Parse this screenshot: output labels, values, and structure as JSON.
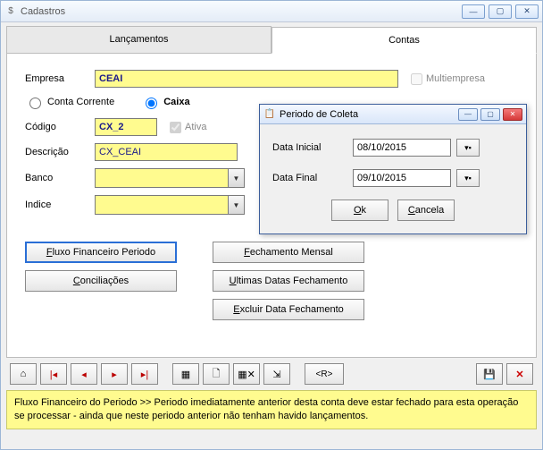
{
  "window": {
    "title": "Cadastros"
  },
  "tabs": {
    "lancamentos": "Lançamentos",
    "contas": "Contas"
  },
  "form": {
    "empresa_label": "Empresa",
    "empresa_value": "CEAI",
    "multiempresa_label": "Multiempresa",
    "radio_conta": "Conta Corrente",
    "radio_caixa": "Caixa",
    "codigo_label": "Código",
    "codigo_value": "CX_2",
    "ativa_label": "Ativa",
    "descricao_label": "Descrição",
    "descricao_value": "CX_CEAI",
    "banco_label": "Banco",
    "indice_label": "Indice"
  },
  "buttons": {
    "fluxo": "Fluxo Financeiro Periodo",
    "conciliacoes": "Conciliações",
    "fechamento": "Fechamento Mensal",
    "ultimas": "Ultimas Datas Fechamento",
    "excluir": "Excluir Data Fechamento"
  },
  "dialog": {
    "title": "Periodo de Coleta",
    "data_inicial_label": "Data Inicial",
    "data_inicial_value": "08/10/2015",
    "data_final_label": "Data Final",
    "data_final_value": "09/10/2015",
    "ok": "Ok",
    "cancela": "Cancela"
  },
  "toolbar": {
    "refresh": "<R>"
  },
  "status": "Fluxo Financeiro do Periodo >> Periodo imediatamente anterior desta conta deve estar fechado para esta operação se processar - ainda que neste periodo anterior não tenham havido lançamentos."
}
